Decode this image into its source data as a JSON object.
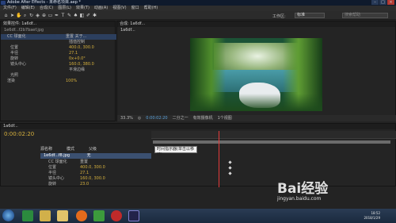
{
  "window": {
    "title": "Adobe After Effects - 未命名项目.aep *"
  },
  "menu": [
    "文件(F)",
    "编辑(E)",
    "合成(C)",
    "图层(L)",
    "效果(T)",
    "动画(A)",
    "视图(V)",
    "窗口",
    "帮助(H)"
  ],
  "toolbar": {
    "workspace_label": "工作区:",
    "workspace_value": "标准",
    "search_placeholder": "搜索帮助"
  },
  "effect_controls": {
    "tab": "效果控件: 1a6df...",
    "source": "1e6df...f2b7baef.jpg",
    "rows": [
      {
        "name": "CC 球面化",
        "value": "重置  关于..."
      },
      {
        "name": "",
        "value": "插值控制"
      },
      {
        "name": "位置",
        "value": "400.0, 300.0"
      },
      {
        "name": "半径",
        "value": "27.1"
      },
      {
        "name": "旋转",
        "value": "0x+0.0°"
      },
      {
        "name": "镜头中心",
        "value": "160.0, 380.0"
      },
      {
        "name": "",
        "value": "平滑边缘"
      },
      {
        "name": "光照",
        "value": ""
      },
      {
        "name": "渲染",
        "value": "100%"
      }
    ]
  },
  "composition": {
    "tab": "合成: 1a6df...",
    "subtab": "1a6df...",
    "bottom": {
      "zoom": "33.3%",
      "timecode": "0:00:02:20",
      "resolution": "二分之一",
      "camera": "有效摄像机",
      "views": "1个视图"
    }
  },
  "timeline": {
    "tab": "1a6df...",
    "timecode": "0:00:02:20",
    "columns": [
      "源名称",
      "模式",
      "父级"
    ],
    "layer": {
      "name": "1e6df...f8.jpg",
      "mode": "无"
    },
    "props": [
      {
        "name": "CC 球面化",
        "value": "重置"
      },
      {
        "name": "位置",
        "value": "400.0, 300.0"
      },
      {
        "name": "半径",
        "value": "27.1"
      },
      {
        "name": "镜头中心",
        "value": "160.0, 300.0"
      },
      {
        "name": "旋转",
        "value": "23.0"
      }
    ],
    "tooltip": "时间指示器(单击以移动)"
  },
  "taskbar": {
    "clock_time": "18:52",
    "clock_date": "2018/1/29"
  },
  "watermark": {
    "brand": "Bai经验",
    "url": "jingyan.baidu.com"
  }
}
